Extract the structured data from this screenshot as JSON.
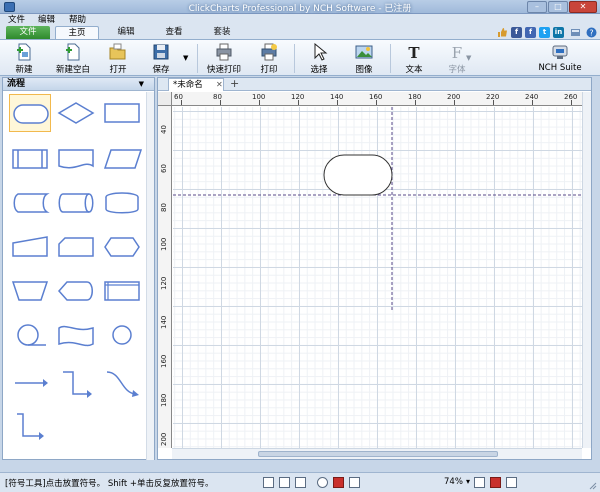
{
  "window": {
    "title": "ClickCharts Professional by NCH Software - 已注册"
  },
  "menu": [
    "文件",
    "编辑",
    "帮助"
  ],
  "tabs": {
    "file": "文件",
    "home": "主页",
    "edit": "编辑",
    "view": "查看",
    "suite": "套装"
  },
  "social": [
    {
      "name": "facebook-like",
      "label": "f",
      "color": "#3b5998"
    },
    {
      "name": "facebook",
      "label": "f",
      "color": "#4267b2"
    },
    {
      "name": "twitter",
      "label": "t",
      "color": "#1da1f2"
    },
    {
      "name": "linkedin",
      "label": "in",
      "color": "#0e76a8"
    }
  ],
  "ribbon": {
    "new": "新建",
    "new_blank": "新建空白",
    "open": "打开",
    "save": "保存",
    "quick_print": "快速打印",
    "print": "打印",
    "select": "选择",
    "image": "图像",
    "text": "文本",
    "font": "字体",
    "nch_suite": "NCH Suite"
  },
  "panel": {
    "title": "流程"
  },
  "document": {
    "tab": "*未命名"
  },
  "ruler": {
    "top": [
      "60",
      "80",
      "100",
      "120",
      "140",
      "160",
      "180",
      "200",
      "220",
      "240",
      "260"
    ],
    "left": [
      "40",
      "60",
      "80",
      "100",
      "120",
      "140",
      "160",
      "180",
      "200"
    ]
  },
  "status": {
    "text": "[符号工具]点击放置符号。 Shift +单击反复放置符号。",
    "zoom": "74%"
  }
}
